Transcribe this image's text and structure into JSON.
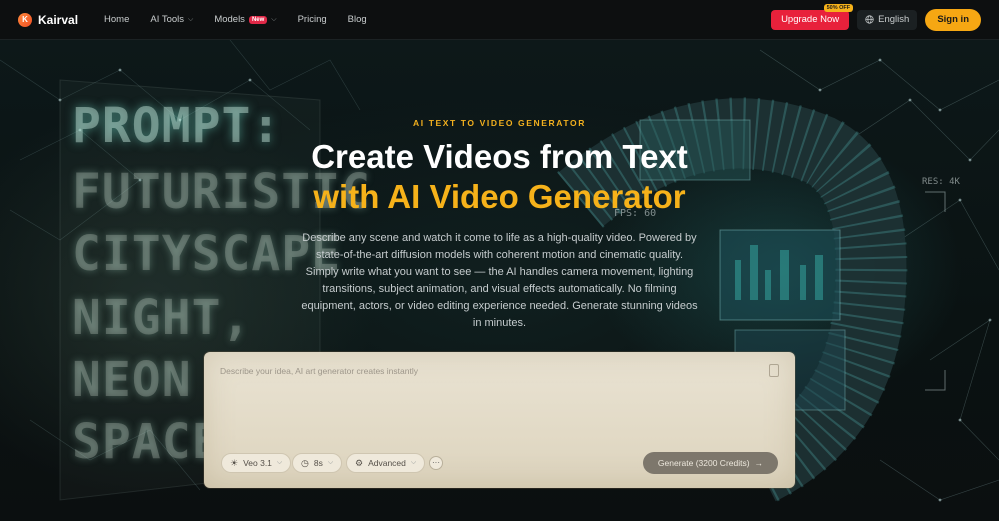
{
  "nav": {
    "brand": "Kairval",
    "brand_letter": "K",
    "links": [
      {
        "label": "Home",
        "dropdown": false
      },
      {
        "label": "AI Tools",
        "dropdown": true
      },
      {
        "label": "Models",
        "dropdown": true,
        "badge": "New"
      },
      {
        "label": "Pricing",
        "dropdown": false
      },
      {
        "label": "Blog",
        "dropdown": false
      }
    ],
    "upgrade_label": "Upgrade Now",
    "upgrade_badge": "50% OFF",
    "language_label": "English",
    "signin_label": "Sign in"
  },
  "hero": {
    "eyebrow": "AI TEXT TO VIDEO GENERATOR",
    "title_line1": "Create Videos from Text",
    "title_line2": "with AI Video Generator",
    "description": "Describe any scene and watch it come to life as a high-quality video. Powered by state-of-the-art diffusion models with coherent motion and cinematic quality. Simply write what you want to see — the AI handles camera movement, lighting transitions, subject animation, and visual effects automatically. No filming equipment, actors, or video editing experience needed. Generate stunning videos in minutes."
  },
  "background": {
    "prompt_words": [
      "PROMPT:",
      "FUTURISTIC",
      "CITYSCAPE",
      "NIGHT,",
      "NEON",
      "SPACE"
    ],
    "hud_res": "RES: 4K",
    "hud_fps": "FPS: 60"
  },
  "composer": {
    "placeholder": "Describe your idea, AI art generator creates instantly",
    "model_label": "Veo 3.1",
    "duration_label": "8s",
    "advanced_label": "Advanced",
    "more_label": "···",
    "generate_label": "Generate (3200 Credits)"
  },
  "colors": {
    "accent": "#f6b21a",
    "upgrade": "#e8213b",
    "signin": "#f6a713",
    "new_badge": "#e02847"
  }
}
